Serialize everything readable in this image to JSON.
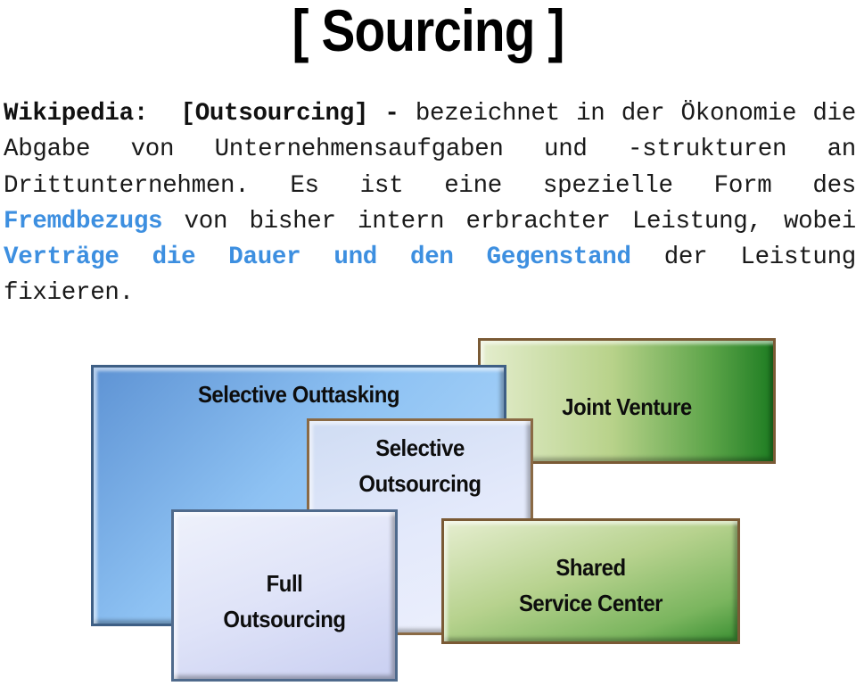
{
  "title": "[ Sourcing ]",
  "definition": {
    "source": "Wikipedia:",
    "term": "[Outsourcing]",
    "dash": "-",
    "text_1": " bezeichnet in der Ökonomie die Abgabe von Unternehmensaufgaben und -strukturen an Drittunternehmen. Es ist eine spezielle Form des ",
    "highlight_1": "Fremdbezugs",
    "text_2": " von bisher intern erbrachter Leistung, wobei ",
    "highlight_2": "Verträge die Dauer und den Gegenstand",
    "text_3": " der Leistung fixieren.",
    "highlight_color": "#3d8fe0"
  },
  "diagram": {
    "boxes": [
      {
        "id": "selective-outtasking",
        "line1": "Selective Outtasking",
        "line2": "",
        "color": "#8ec2f3"
      },
      {
        "id": "joint-venture",
        "line1": "Joint Venture",
        "line2": "",
        "color": "#5ea54a"
      },
      {
        "id": "selective-outsourcing",
        "line1": "Selective",
        "line2": "Outsourcing",
        "color": "#e3e9fb"
      },
      {
        "id": "full-outsourcing",
        "line1": "Full",
        "line2": "Outsourcing",
        "color": "#dfe3f8"
      },
      {
        "id": "shared-service-center",
        "line1": "Shared",
        "line2": "Service Center",
        "color": "#b7d28e"
      }
    ]
  }
}
